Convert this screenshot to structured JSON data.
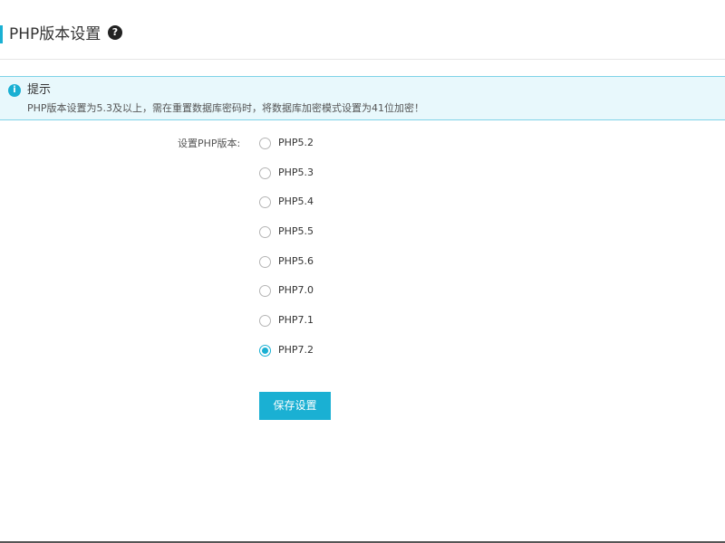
{
  "header": {
    "title": "PHP版本设置",
    "help_icon": "question-circle-icon",
    "help_glyph": "?",
    "accent_color": "#1ab0d3"
  },
  "notice": {
    "icon": "info-icon",
    "icon_glyph": "i",
    "title": "提示",
    "text": "PHP版本设置为5.3及以上，需在重置数据库密码时，将数据库加密模式设置为41位加密！"
  },
  "form": {
    "label": "设置PHP版本:",
    "options": [
      {
        "label": "PHP5.2",
        "checked": false
      },
      {
        "label": "PHP5.3",
        "checked": false
      },
      {
        "label": "PHP5.4",
        "checked": false
      },
      {
        "label": "PHP5.5",
        "checked": false
      },
      {
        "label": "PHP5.6",
        "checked": false
      },
      {
        "label": "PHP7.0",
        "checked": false
      },
      {
        "label": "PHP7.1",
        "checked": false
      },
      {
        "label": "PHP7.2",
        "checked": true
      }
    ],
    "selected": "PHP7.2",
    "save_label": "保存设置"
  }
}
